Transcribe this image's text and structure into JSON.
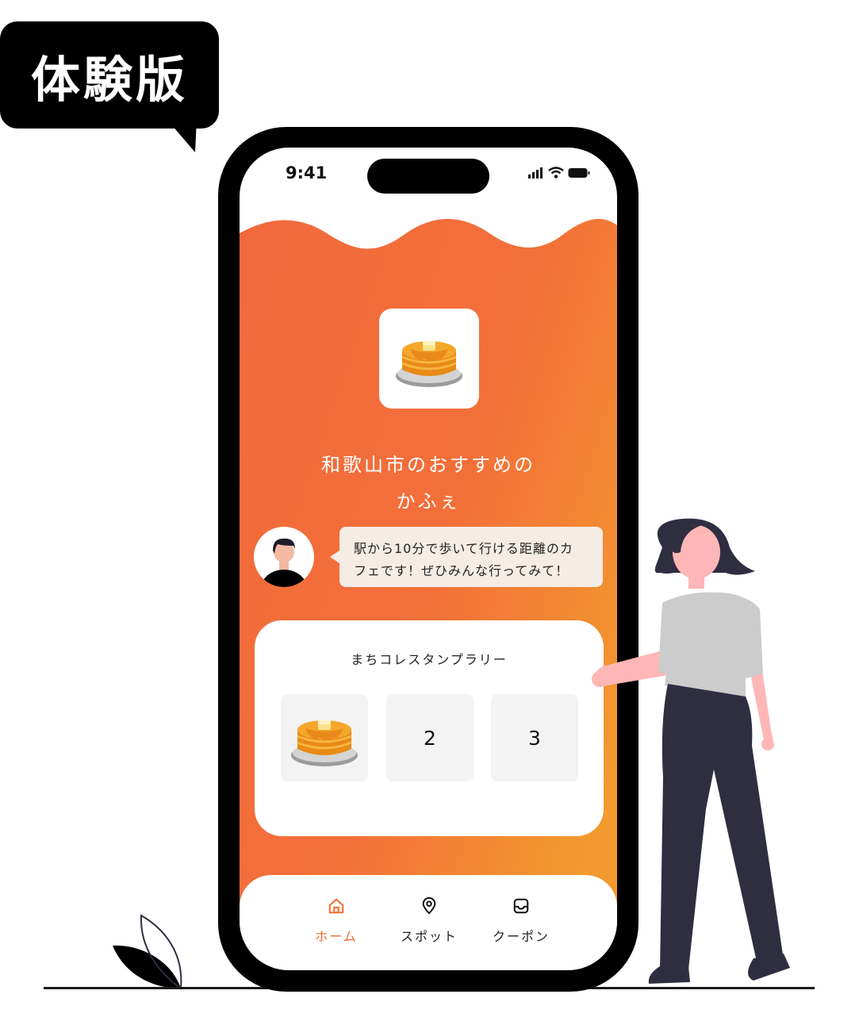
{
  "badge": {
    "label": "体験版"
  },
  "status_bar": {
    "time": "9:41"
  },
  "header": {
    "title_line1": "和歌山市のおすすめの",
    "title_line2": "かふぇ",
    "icon": "pancake-icon"
  },
  "guide": {
    "message_line1": "駅から10分で歩いて行ける距離のカ",
    "message_line2": "フェです！ぜひみんな行ってみて！"
  },
  "stamp_rally": {
    "title": "まちコレスタンプラリー",
    "slots": [
      {
        "icon": "pancake-icon",
        "label": ""
      },
      {
        "label": "2"
      },
      {
        "label": "3"
      }
    ]
  },
  "bottom_nav": {
    "items": [
      {
        "label": "ホーム",
        "icon": "home-icon",
        "active": true
      },
      {
        "label": "スポット",
        "icon": "location-pin-icon",
        "active": false
      },
      {
        "label": "クーポン",
        "icon": "inbox-icon",
        "active": false
      }
    ]
  },
  "colors": {
    "accent": "#f26b2f",
    "gradient_start": "#f26a3c",
    "gradient_end": "#f39a2e",
    "person_shirt": "#cccccc",
    "person_pants": "#2f2e41",
    "person_skin": "#ffb6b6"
  }
}
